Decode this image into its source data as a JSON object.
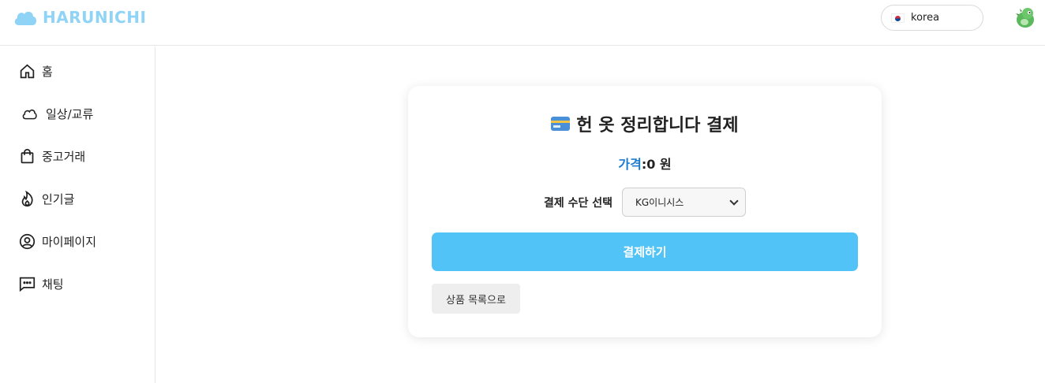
{
  "header": {
    "logo_text": "HARUNICHI",
    "language": "korea",
    "language_flag": "korea-flag-icon",
    "avatar_icon": "dinosaur-avatar-icon"
  },
  "sidebar": {
    "items": [
      {
        "label": "홈",
        "icon": "home-icon"
      },
      {
        "label": "일상/교류",
        "icon": "cloud-icon"
      },
      {
        "label": "중고거래",
        "icon": "shopping-bag-icon"
      },
      {
        "label": "인기글",
        "icon": "fire-icon"
      },
      {
        "label": "마이페이지",
        "icon": "user-circle-icon"
      },
      {
        "label": "채팅",
        "icon": "chat-icon"
      }
    ]
  },
  "payment": {
    "title_icon": "credit-card-icon",
    "title": "헌 옷 정리합니다 결제",
    "price_label": "가격",
    "price_value": ":0 원",
    "method_label": "결제 수단 선택",
    "method_selected": "KG이니시스",
    "pay_button": "결제하기",
    "back_button": "상품 목록으로"
  },
  "colors": {
    "accent": "#52c3f6",
    "logo": "#8fd3f7",
    "price_label": "#1a7bd0"
  }
}
